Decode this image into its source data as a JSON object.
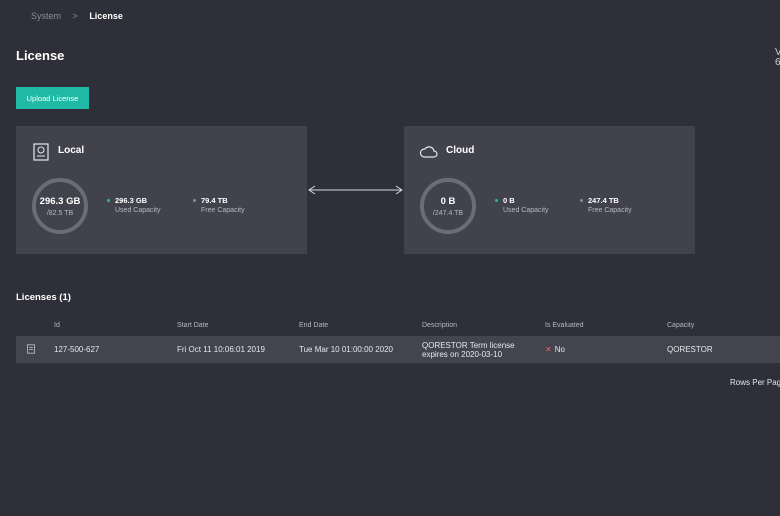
{
  "breadcrumb": {
    "parent": "System",
    "separator": ">",
    "current": "License"
  },
  "page": {
    "title": "License",
    "right_clip_top": "V",
    "right_clip_bottom": "6"
  },
  "actions": {
    "upload_label": "Upload License"
  },
  "cards": {
    "local": {
      "title": "Local",
      "donut_value": "296.3 GB",
      "donut_total": "/82.5 TB",
      "used_value": "296.3 GB",
      "used_label": "Used Capacity",
      "free_value": "79.4 TB",
      "free_label": "Free Capacity"
    },
    "cloud": {
      "title": "Cloud",
      "donut_value": "0 B",
      "donut_total": "/247.4 TB",
      "used_value": "0 B",
      "used_label": "Used Capacity",
      "free_value": "247.4 TB",
      "free_label": "Free Capacity"
    }
  },
  "licenses": {
    "title": "Licenses (1)",
    "columns": [
      "Id",
      "Start Date",
      "End Date",
      "Description",
      "Is Evaluated",
      "Capacity"
    ],
    "rows": [
      {
        "id": "127-500-627",
        "start": "Fri Oct 11 10:06:01 2019",
        "end": "Tue Mar 10 01:00:00 2020",
        "description": "QORESTOR Term license expires on 2020-03-10",
        "evaluated": "No",
        "capacity": "QORESTOR"
      }
    ]
  },
  "footer": {
    "rows_per_page": "Rows Per Pag"
  },
  "colors": {
    "accent": "#1fb9a6",
    "used_dot": "#2bb3a3",
    "free_dot": "#8a8c96",
    "error": "#ff5b5b"
  },
  "icons": {
    "local": "local-storage-icon",
    "cloud": "cloud-icon",
    "row": "document-icon",
    "connector": "double-arrow-icon"
  }
}
